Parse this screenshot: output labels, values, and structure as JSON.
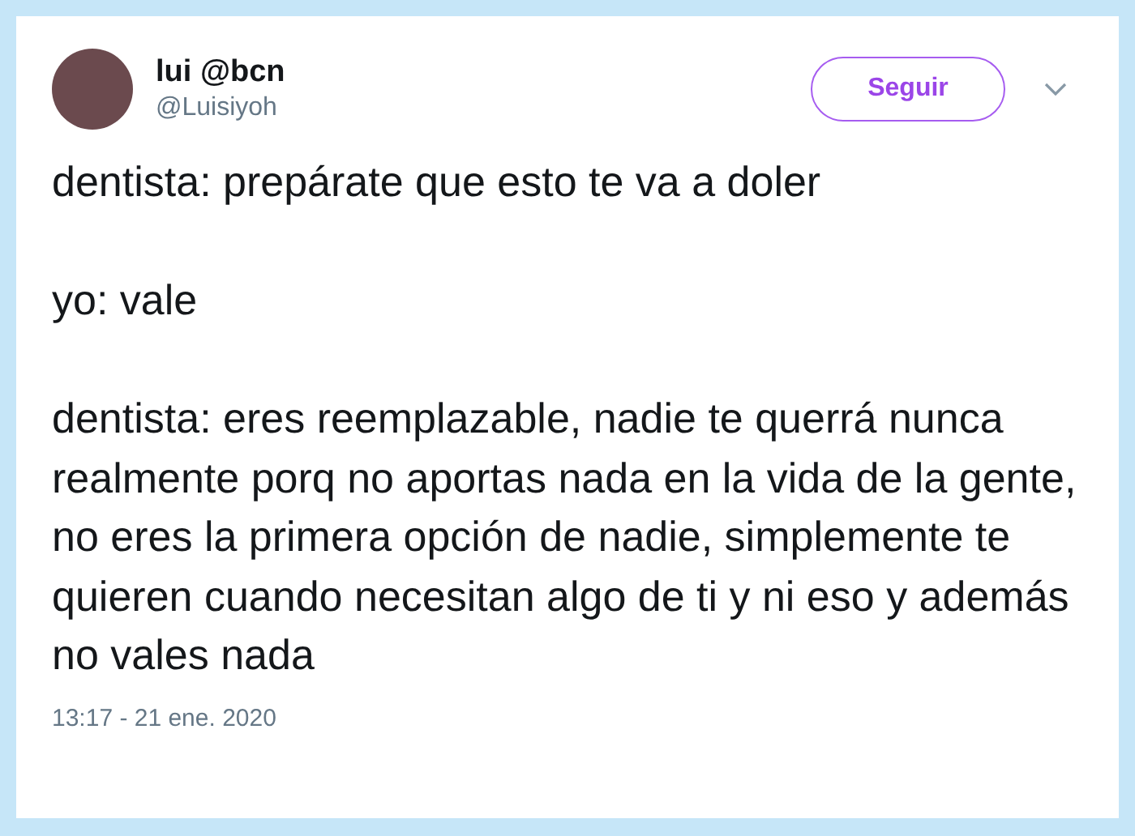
{
  "author": {
    "name": "lui @bcn",
    "handle": "@Luisiyoh"
  },
  "follow_button": {
    "label": "Seguir"
  },
  "paragraphs": [
    "dentista: prepárate que esto te va a doler",
    "yo: vale",
    "dentista: eres reemplazable, nadie te querrá nunca realmente porq no aportas nada en la vida de la gente, no eres la primera opción de nadie, simplemente te quieren cuando necesitan algo de ti y ni eso y además no vales nada"
  ],
  "timestamp": "13:17 - 21 ene. 2020"
}
